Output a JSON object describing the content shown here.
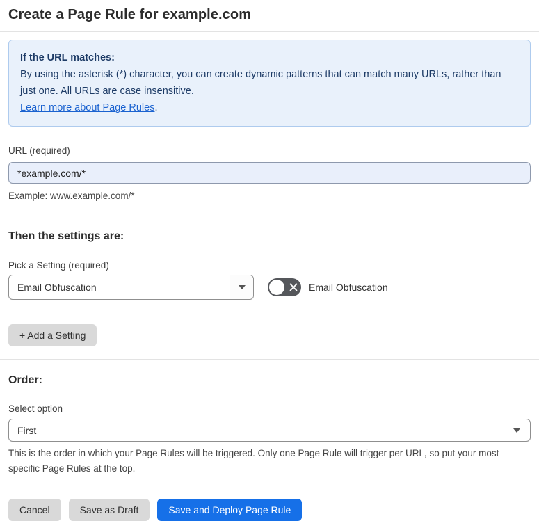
{
  "page": {
    "title": "Create a Page Rule for example.com"
  },
  "info_box": {
    "heading": "If the URL matches:",
    "body": "By using the asterisk (*) character, you can create dynamic patterns that can match many URLs, rather than just one. All URLs are case insensitive.",
    "link_label": "Learn more about Page Rules",
    "link_suffix": "."
  },
  "url_section": {
    "label": "URL (required)",
    "value": "*example.com/*",
    "helper": "Example: www.example.com/*"
  },
  "settings_section": {
    "heading": "Then the settings are:",
    "picker_label": "Pick a Setting (required)",
    "selected_setting": "Email Obfuscation",
    "toggle": {
      "label": "Email Obfuscation",
      "state": "off"
    },
    "add_button_label": "+ Add a Setting"
  },
  "order_section": {
    "heading": "Order:",
    "select_label": "Select option",
    "selected_option": "First",
    "helper": "This is the order in which your Page Rules will be triggered. Only one Page Rule will trigger per URL, so put your most specific Page Rules at the top."
  },
  "footer": {
    "cancel_label": "Cancel",
    "save_draft_label": "Save as Draft",
    "save_deploy_label": "Save and Deploy Page Rule"
  },
  "colors": {
    "info_bg": "#e9f1fb",
    "info_border": "#aecbee",
    "info_text": "#1d3b66",
    "link": "#1a62d0",
    "url_input_bg": "#e9effb",
    "primary_button_bg": "#1670e8",
    "secondary_button_bg": "#d9d9d9",
    "toggle_off_bg": "#55575b"
  }
}
